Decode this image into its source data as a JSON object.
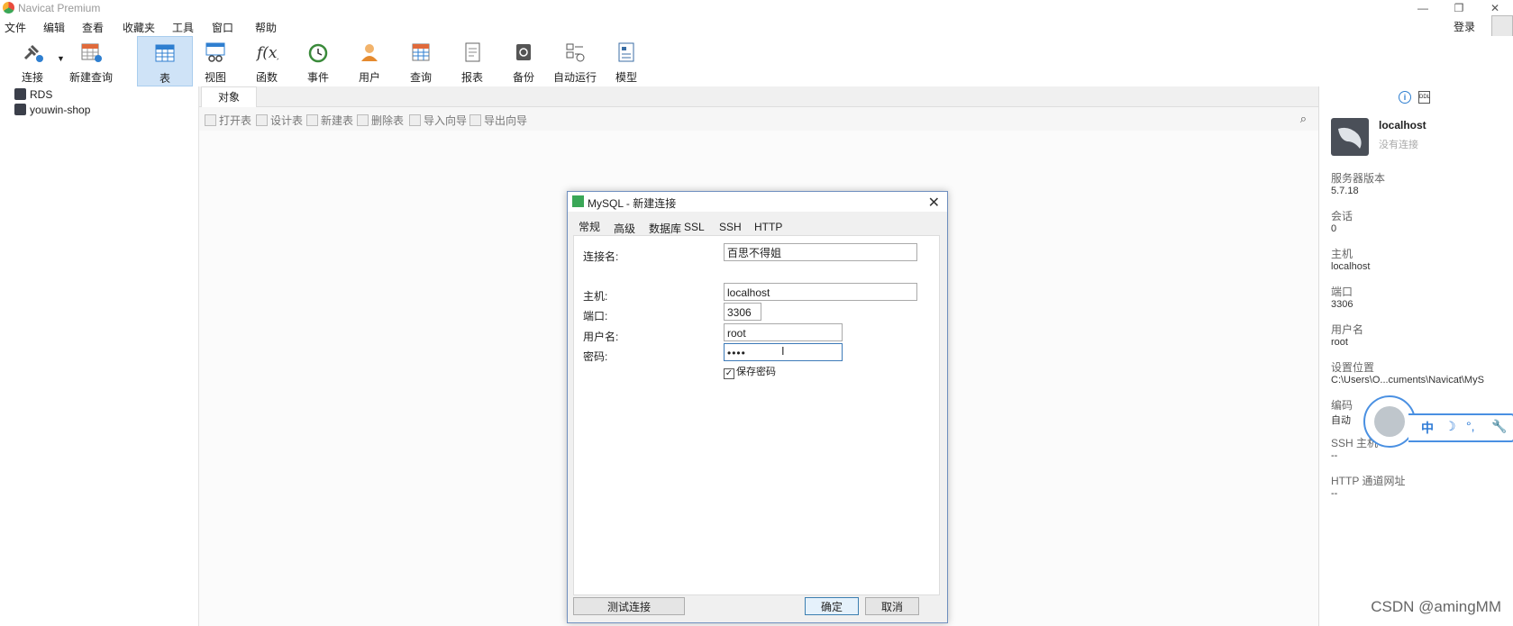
{
  "app": {
    "title": "Navicat Premium",
    "login": "登录"
  },
  "menu": [
    "文件",
    "编辑",
    "查看",
    "收藏夹",
    "工具",
    "窗口",
    "帮助"
  ],
  "toolbar": [
    {
      "label": "连接",
      "icon": "plug-icon"
    },
    {
      "label": "新建查询",
      "icon": "new-query-icon"
    },
    {
      "label": "表",
      "icon": "table-icon"
    },
    {
      "label": "视图",
      "icon": "view-icon"
    },
    {
      "label": "函数",
      "icon": "function-icon"
    },
    {
      "label": "事件",
      "icon": "clock-icon"
    },
    {
      "label": "用户",
      "icon": "user-icon"
    },
    {
      "label": "查询",
      "icon": "query-icon"
    },
    {
      "label": "报表",
      "icon": "report-icon"
    },
    {
      "label": "备份",
      "icon": "backup-icon"
    },
    {
      "label": "自动运行",
      "icon": "automation-icon"
    },
    {
      "label": "模型",
      "icon": "model-icon"
    }
  ],
  "tree": [
    "RDS",
    "youwin-shop"
  ],
  "tabs": {
    "objects": "对象"
  },
  "object_tools": [
    "打开表",
    "设计表",
    "新建表",
    "删除表",
    "导入向导",
    "导出向导"
  ],
  "dialog": {
    "title": "MySQL - 新建连接",
    "tabs": [
      "常规",
      "高级",
      "数据库",
      "SSL",
      "SSH",
      "HTTP"
    ],
    "fields": {
      "conn_name_label": "连接名:",
      "conn_name_value": "百思不得姐",
      "host_label": "主机:",
      "host_value": "localhost",
      "port_label": "端口:",
      "port_value": "3306",
      "user_label": "用户名:",
      "user_value": "root",
      "password_label": "密码:",
      "password_value": "••••"
    },
    "save_password": "保存密码",
    "buttons": {
      "test": "测试连接",
      "ok": "确定",
      "cancel": "取消"
    }
  },
  "info_panel": {
    "name": "localhost",
    "status": "没有连接",
    "items": [
      {
        "label": "服务器版本",
        "value": "5.7.18"
      },
      {
        "label": "会话",
        "value": "0"
      },
      {
        "label": "主机",
        "value": "localhost"
      },
      {
        "label": "端口",
        "value": "3306"
      },
      {
        "label": "用户名",
        "value": "root"
      },
      {
        "label": "设置位置",
        "value": "C:\\Users\\O...cuments\\Navicat\\MyS"
      },
      {
        "label": "编码",
        "value": "自动"
      },
      {
        "label": "SSH 主机",
        "value": "--"
      },
      {
        "label": "HTTP 通道网址",
        "value": "--"
      }
    ]
  },
  "assistant": [
    "中",
    "☽",
    "°,",
    "🔧"
  ],
  "watermark": "CSDN @amingMM",
  "colors": {
    "accent": "#4a90e2",
    "active_tab": "#cfe3f7"
  }
}
